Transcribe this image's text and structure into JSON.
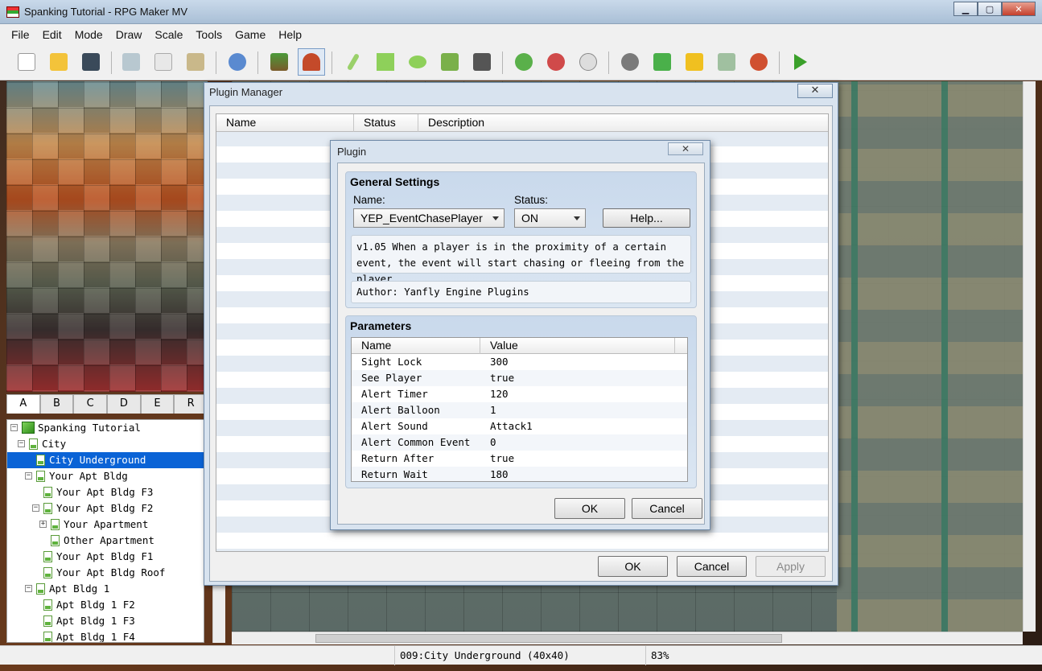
{
  "window": {
    "title": "Spanking Tutorial - RPG Maker MV",
    "min": "▁",
    "max": "▢",
    "close": "✕"
  },
  "menu": [
    "File",
    "Edit",
    "Mode",
    "Draw",
    "Scale",
    "Tools",
    "Game",
    "Help"
  ],
  "toolbar_icons": [
    "new-project-icon",
    "open-project-icon",
    "save-project-icon",
    "cut-icon",
    "copy-icon",
    "paste-icon",
    "undo-icon",
    "map-mode-icon",
    "event-mode-icon",
    "pencil-icon",
    "rectangle-icon",
    "ellipse-icon",
    "flood-fill-icon",
    "shadow-pen-icon",
    "zoom-in-icon",
    "zoom-out-icon",
    "actual-size-icon",
    "database-icon",
    "plugin-manager-icon",
    "sound-test-icon",
    "event-searcher-icon",
    "character-generator-icon",
    "playtest-icon"
  ],
  "tile_tabs": [
    "A",
    "B",
    "C",
    "D",
    "E",
    "R"
  ],
  "map_tree": [
    {
      "label": "Spanking Tutorial",
      "depth": 0,
      "kind": "project",
      "expander": "⊟"
    },
    {
      "label": "City",
      "depth": 1,
      "kind": "map",
      "expander": "⊟"
    },
    {
      "label": "City Underground",
      "depth": 2,
      "kind": "map",
      "selected": true
    },
    {
      "label": "Your Apt Bldg",
      "depth": 2,
      "kind": "map",
      "expander": "⊟"
    },
    {
      "label": "Your Apt Bldg F3",
      "depth": 3,
      "kind": "map"
    },
    {
      "label": "Your Apt Bldg F2",
      "depth": 3,
      "kind": "map",
      "expander": "⊟"
    },
    {
      "label": "Your Apartment",
      "depth": 4,
      "kind": "map",
      "expander": "⊞"
    },
    {
      "label": "Other Apartment",
      "depth": 4,
      "kind": "map"
    },
    {
      "label": "Your Apt Bldg F1",
      "depth": 3,
      "kind": "map"
    },
    {
      "label": "Your Apt Bldg Roof",
      "depth": 3,
      "kind": "map"
    },
    {
      "label": "Apt Bldg 1",
      "depth": 2,
      "kind": "map",
      "expander": "⊟"
    },
    {
      "label": "Apt Bldg 1 F2",
      "depth": 3,
      "kind": "map"
    },
    {
      "label": "Apt Bldg 1 F3",
      "depth": 3,
      "kind": "map"
    },
    {
      "label": "Apt Bldg 1 F4",
      "depth": 3,
      "kind": "map"
    }
  ],
  "status": {
    "map": "009:City Underground (40x40)",
    "zoom": "83%"
  },
  "plugin_manager": {
    "title": "Plugin Manager",
    "close": "✕",
    "columns": [
      "Name",
      "Status",
      "Description"
    ],
    "ok": "OK",
    "cancel": "Cancel",
    "apply": "Apply"
  },
  "plugin_dialog": {
    "title": "Plugin",
    "close": "✕",
    "general_settings": "General Settings",
    "name_label": "Name:",
    "name_value": "YEP_EventChasePlayer",
    "status_label": "Status:",
    "status_value": "ON",
    "help": "Help...",
    "description": "v1.05 When a player is in the proximity of a certain event, the event will start chasing or fleeing from the player.",
    "author": "Author: Yanfly Engine Plugins",
    "parameters_title": "Parameters",
    "param_columns": [
      "Name",
      "Value"
    ],
    "parameters": [
      {
        "name": "Sight Lock",
        "value": "300"
      },
      {
        "name": "See Player",
        "value": "true"
      },
      {
        "name": "Alert Timer",
        "value": "120"
      },
      {
        "name": "Alert Balloon",
        "value": "1"
      },
      {
        "name": "Alert Sound",
        "value": "Attack1"
      },
      {
        "name": "Alert Common Event",
        "value": "0"
      },
      {
        "name": "Return After",
        "value": "true"
      },
      {
        "name": "Return Wait",
        "value": "180"
      }
    ],
    "ok": "OK",
    "cancel": "Cancel"
  },
  "colors": {
    "selection": "#0a63d6",
    "dialog_frame": "#d8e3ef",
    "group_fill": "#c9d9ec"
  }
}
